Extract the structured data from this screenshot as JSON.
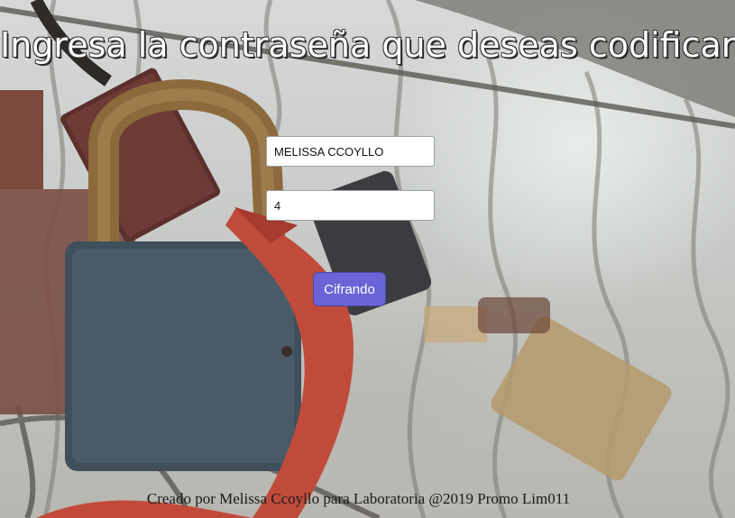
{
  "page": {
    "title": "Ingresa la contraseña que deseas codificar:",
    "footer": "Creado por Melissa Ccoyllo para Laboratoria @2019 Promo Lim011"
  },
  "form": {
    "password_value": "MELISSA CCOYLLO",
    "offset_value": "4",
    "submit_label": "Cifrando"
  },
  "colors": {
    "button": "#6a64d6",
    "title_text": "#ffffff"
  }
}
